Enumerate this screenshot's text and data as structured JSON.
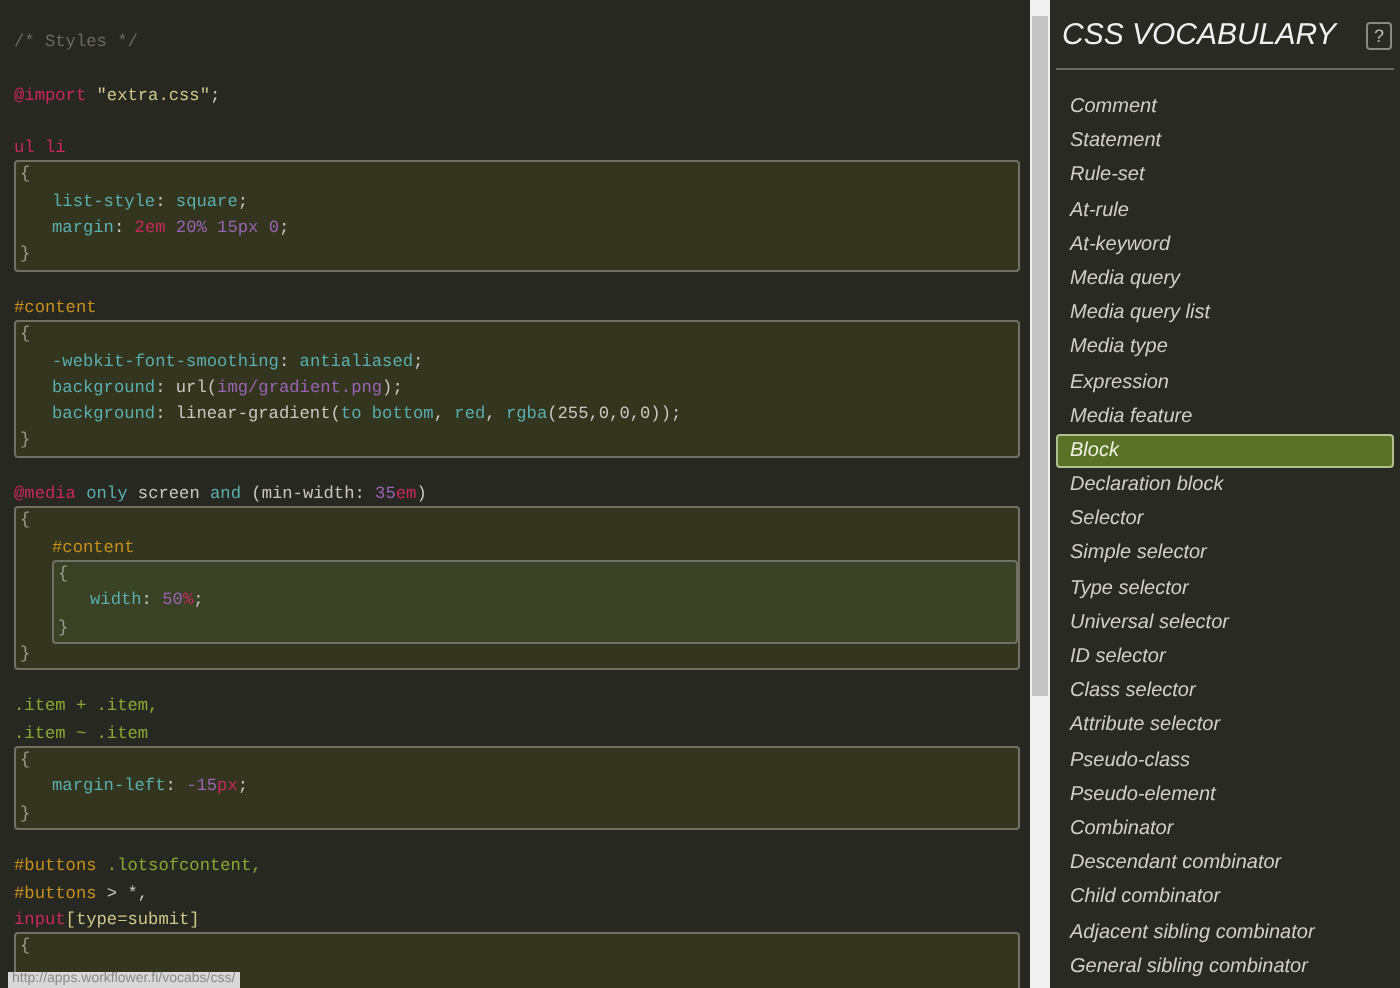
{
  "editor": {
    "items": [
      {
        "kind": "line",
        "tokens": [
          {
            "text": "/* Styles */",
            "color": "#6a6a5e"
          }
        ]
      },
      {
        "kind": "blank"
      },
      {
        "kind": "line",
        "tokens": [
          {
            "text": "@import",
            "color": "#c8285e"
          },
          {
            "text": " \"extra.css\"",
            "color": "#cdc78a"
          },
          {
            "text": ";",
            "color": "#c8c8c0"
          }
        ]
      },
      {
        "kind": "blank"
      },
      {
        "kind": "line",
        "tokens": [
          {
            "text": "ul li",
            "color": "#c8285e"
          }
        ]
      },
      {
        "kind": "block",
        "open": "{",
        "close": "}",
        "items": [
          {
            "kind": "line",
            "tokens": [
              {
                "text": "list-style",
                "color": "#5aaeae"
              },
              {
                "text": ": ",
                "color": "#c8c8c0"
              },
              {
                "text": "square",
                "color": "#5aaeae"
              },
              {
                "text": ";",
                "color": "#c8c8c0"
              }
            ]
          },
          {
            "kind": "line",
            "tokens": [
              {
                "text": "margin",
                "color": "#5aaeae"
              },
              {
                "text": ": ",
                "color": "#c8c8c0"
              },
              {
                "text": "2em ",
                "color": "#c8285e"
              },
              {
                "text": "20% 15px 0",
                "color": "#9a64b4"
              },
              {
                "text": ";",
                "color": "#c8c8c0"
              }
            ]
          }
        ]
      },
      {
        "kind": "blank"
      },
      {
        "kind": "line",
        "tokens": [
          {
            "text": "#content",
            "color": "#c8901c"
          }
        ]
      },
      {
        "kind": "block",
        "open": "{",
        "close": "}",
        "items": [
          {
            "kind": "line",
            "tokens": [
              {
                "text": "-webkit-font-smoothing",
                "color": "#5aaeae"
              },
              {
                "text": ": ",
                "color": "#c8c8c0"
              },
              {
                "text": "antialiased",
                "color": "#5aaeae"
              },
              {
                "text": ";",
                "color": "#c8c8c0"
              }
            ]
          },
          {
            "kind": "line",
            "tokens": [
              {
                "text": "background",
                "color": "#5aaeae"
              },
              {
                "text": ": url(",
                "color": "#c8c8c0"
              },
              {
                "text": "img/gradient.png",
                "color": "#9a64b4"
              },
              {
                "text": ");",
                "color": "#c8c8c0"
              }
            ]
          },
          {
            "kind": "line",
            "tokens": [
              {
                "text": "background",
                "color": "#5aaeae"
              },
              {
                "text": ": linear-gradient(",
                "color": "#c8c8c0"
              },
              {
                "text": "to bottom",
                "color": "#5aaeae"
              },
              {
                "text": ", ",
                "color": "#c8c8c0"
              },
              {
                "text": "red",
                "color": "#5aaeae"
              },
              {
                "text": ", ",
                "color": "#c8c8c0"
              },
              {
                "text": "rgba",
                "color": "#5aaeae"
              },
              {
                "text": "(255,0,0,0));",
                "color": "#c8c8c0"
              }
            ]
          }
        ]
      },
      {
        "kind": "blank"
      },
      {
        "kind": "line",
        "tokens": [
          {
            "text": "@media",
            "color": "#c8285e"
          },
          {
            "text": " only",
            "color": "#5aaeae"
          },
          {
            "text": " screen ",
            "color": "#c8c8c0"
          },
          {
            "text": "and",
            "color": "#5aaeae"
          },
          {
            "text": " (min-width: ",
            "color": "#c8c8c0"
          },
          {
            "text": "35",
            "color": "#9a64b4"
          },
          {
            "text": "em",
            "color": "#c8285e"
          },
          {
            "text": ")",
            "color": "#c8c8c0"
          }
        ]
      },
      {
        "kind": "block",
        "open": "{",
        "close": "}",
        "items": [
          {
            "kind": "line",
            "tokens": [
              {
                "text": "#content",
                "color": "#c8901c"
              }
            ]
          },
          {
            "kind": "block",
            "open": "{",
            "close": "}",
            "items": [
              {
                "kind": "line",
                "tokens": [
                  {
                    "text": "width",
                    "color": "#5aaeae"
                  },
                  {
                    "text": ": ",
                    "color": "#c8c8c0"
                  },
                  {
                    "text": "50",
                    "color": "#9a64b4"
                  },
                  {
                    "text": "%",
                    "color": "#c8285e"
                  },
                  {
                    "text": ";",
                    "color": "#c8c8c0"
                  }
                ]
              }
            ]
          }
        ]
      },
      {
        "kind": "blank"
      },
      {
        "kind": "line",
        "tokens": [
          {
            "text": ".item + .item,",
            "color": "#8ca832"
          }
        ]
      },
      {
        "kind": "line",
        "tokens": [
          {
            "text": ".item ~ .item",
            "color": "#8ca832"
          }
        ]
      },
      {
        "kind": "block",
        "open": "{",
        "close": "}",
        "items": [
          {
            "kind": "line",
            "tokens": [
              {
                "text": "margin-left",
                "color": "#5aaeae"
              },
              {
                "text": ": ",
                "color": "#c8c8c0"
              },
              {
                "text": "-15",
                "color": "#9a64b4"
              },
              {
                "text": "px",
                "color": "#c8285e"
              },
              {
                "text": ";",
                "color": "#c8c8c0"
              }
            ]
          }
        ]
      },
      {
        "kind": "blank"
      },
      {
        "kind": "line",
        "tokens": [
          {
            "text": "#buttons",
            "color": "#c8901c"
          },
          {
            "text": " .lotsofcontent,",
            "color": "#8ca832"
          }
        ]
      },
      {
        "kind": "line",
        "tokens": [
          {
            "text": "#buttons",
            "color": "#c8901c"
          },
          {
            "text": " > *,",
            "color": "#c8c8c0"
          }
        ]
      },
      {
        "kind": "line",
        "tokens": [
          {
            "text": "input",
            "color": "#c8285e"
          },
          {
            "text": "[type=submit]",
            "color": "#cdc78a"
          }
        ]
      },
      {
        "kind": "block",
        "open": "{"
      }
    ]
  },
  "status_bar": {
    "url": "http://apps.workflower.fi/vocabs/css/"
  },
  "sidebar": {
    "title": "CSS VOCABULARY",
    "help": "?",
    "items": [
      {
        "label": "Comment",
        "selected": false
      },
      {
        "label": "Statement",
        "selected": false
      },
      {
        "label": "Rule-set",
        "selected": false
      },
      {
        "label": "At-rule",
        "selected": false
      },
      {
        "label": "At-keyword",
        "selected": false
      },
      {
        "label": "Media query",
        "selected": false
      },
      {
        "label": "Media query list",
        "selected": false
      },
      {
        "label": "Media type",
        "selected": false
      },
      {
        "label": "Expression",
        "selected": false
      },
      {
        "label": "Media feature",
        "selected": false
      },
      {
        "label": "Block",
        "selected": true
      },
      {
        "label": "Declaration block",
        "selected": false
      },
      {
        "label": "Selector",
        "selected": false
      },
      {
        "label": "Simple selector",
        "selected": false
      },
      {
        "label": "Type selector",
        "selected": false
      },
      {
        "label": "Universal selector",
        "selected": false
      },
      {
        "label": "ID selector",
        "selected": false
      },
      {
        "label": "Class selector",
        "selected": false
      },
      {
        "label": "Attribute selector",
        "selected": false
      },
      {
        "label": "Pseudo-class",
        "selected": false
      },
      {
        "label": "Pseudo-element",
        "selected": false
      },
      {
        "label": "Combinator",
        "selected": false
      },
      {
        "label": "Descendant combinator",
        "selected": false
      },
      {
        "label": "Child combinator",
        "selected": false
      },
      {
        "label": "Adjacent sibling combinator",
        "selected": false
      },
      {
        "label": "General sibling combinator",
        "selected": false
      }
    ]
  }
}
